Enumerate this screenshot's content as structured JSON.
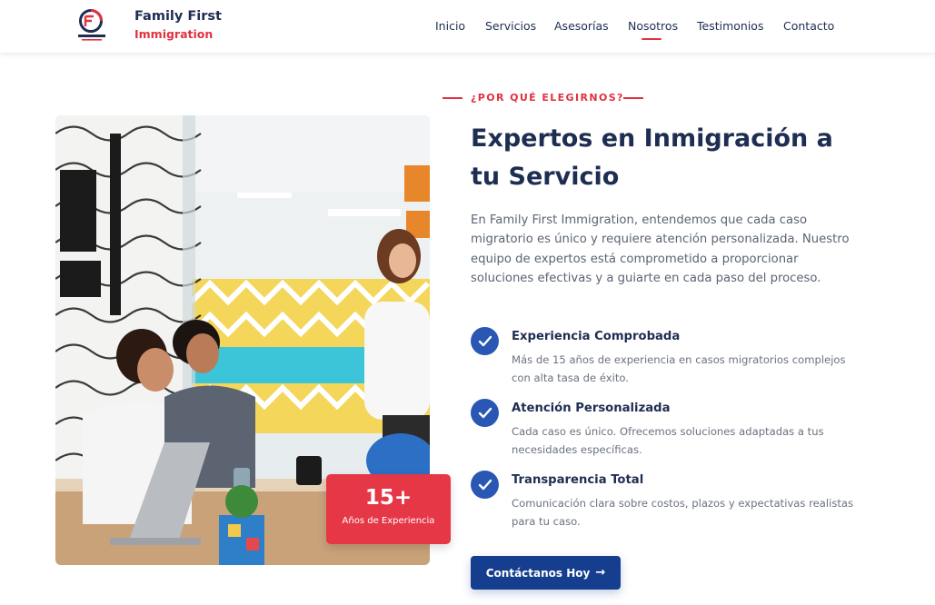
{
  "brand": {
    "name_line1": "Family First",
    "name_line2": "Immigration",
    "logo_caption": "FAMILY FIRST",
    "colors": {
      "navy": "#1e2d52",
      "red": "#e0323f",
      "blue": "#153e8e"
    }
  },
  "nav": {
    "items": [
      {
        "label": "Inicio"
      },
      {
        "label": "Servicios"
      },
      {
        "label": "Asesorías"
      },
      {
        "label": "Nosotros",
        "active": true
      },
      {
        "label": "Testimonios"
      },
      {
        "label": "Contacto"
      }
    ]
  },
  "badge": {
    "number": "15+",
    "label": "Años de Experiencia"
  },
  "about": {
    "eyebrow": "¿POR QUÉ ELEGIRNOS?",
    "title": "Expertos en Inmigración a tu Servicio",
    "lead": "En Family First Immigration, entendemos que cada caso migratorio es único y requiere atención personalizada. Nuestro equipo de expertos está comprometido a proporcionar soluciones efectivas y a guiarte en cada paso del proceso.",
    "features": [
      {
        "icon": "check-icon",
        "title": "Experiencia Comprobada",
        "desc": "Más de 15 años de experiencia en casos migratorios complejos con alta tasa de éxito."
      },
      {
        "icon": "check-icon",
        "title": "Atención Personalizada",
        "desc": "Cada caso es único. Ofrecemos soluciones adaptadas a tus necesidades específicas."
      },
      {
        "icon": "check-icon",
        "title": "Transparencia Total",
        "desc": "Comunicación clara sobre costos, plazos y expectativas realistas para tu caso."
      }
    ],
    "cta_label": "Contáctanos Hoy",
    "cta_icon": "arrow-right-icon"
  }
}
